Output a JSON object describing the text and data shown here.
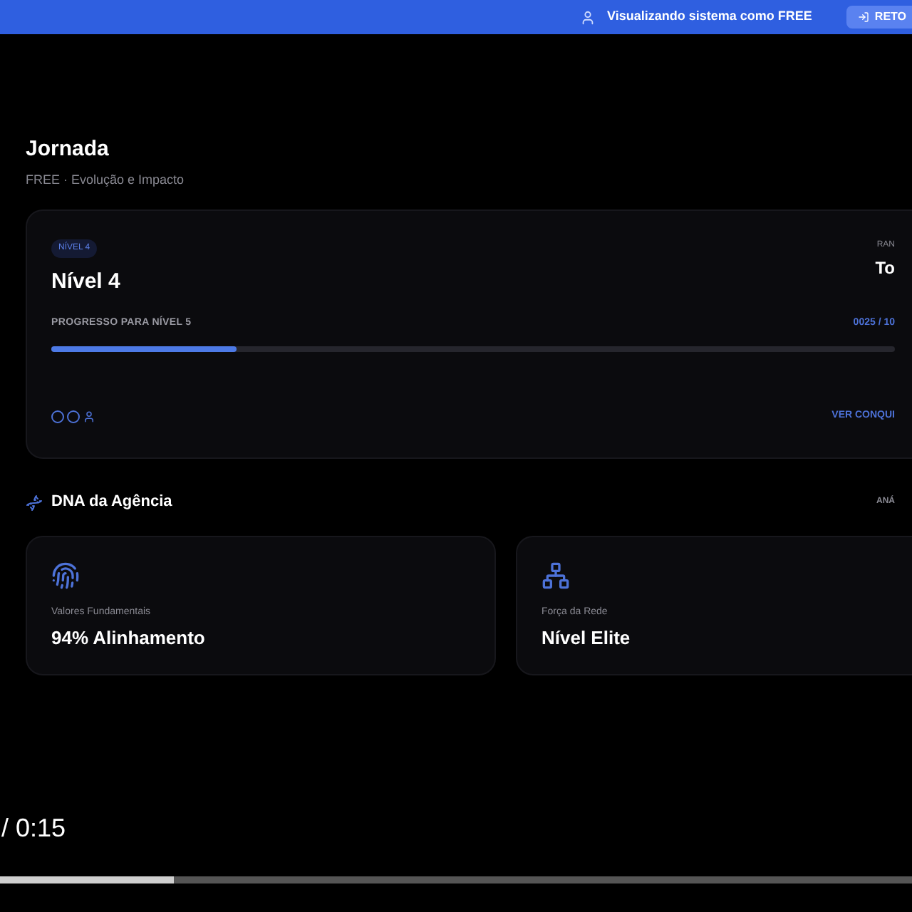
{
  "banner": {
    "text": "Visualizando sistema como FREE",
    "button": "RETO"
  },
  "header": {
    "title": "Jornada",
    "subtitle": "FREE · Evolução e Impacto"
  },
  "level_card": {
    "badge": "NÍVEL 4",
    "title": "Nível 4",
    "side_label": "RAN",
    "side_value": "To",
    "progress_label": "PROGRESSO PARA NÍVEL 5",
    "progress_value": "0025 / 10",
    "level": 0.22,
    "link": "VER CONQUI"
  },
  "dna": {
    "title": "DNA da Agência",
    "link": "ANÁ",
    "cards": [
      {
        "kind": "fingerprint",
        "label": "Valores Fundamentais",
        "value": "94% Alinhamento"
      },
      {
        "kind": "network",
        "label": "Força da Rede",
        "value": "Nível Elite"
      }
    ]
  },
  "video": {
    "time": "/ 0:15",
    "level": 0.19
  }
}
